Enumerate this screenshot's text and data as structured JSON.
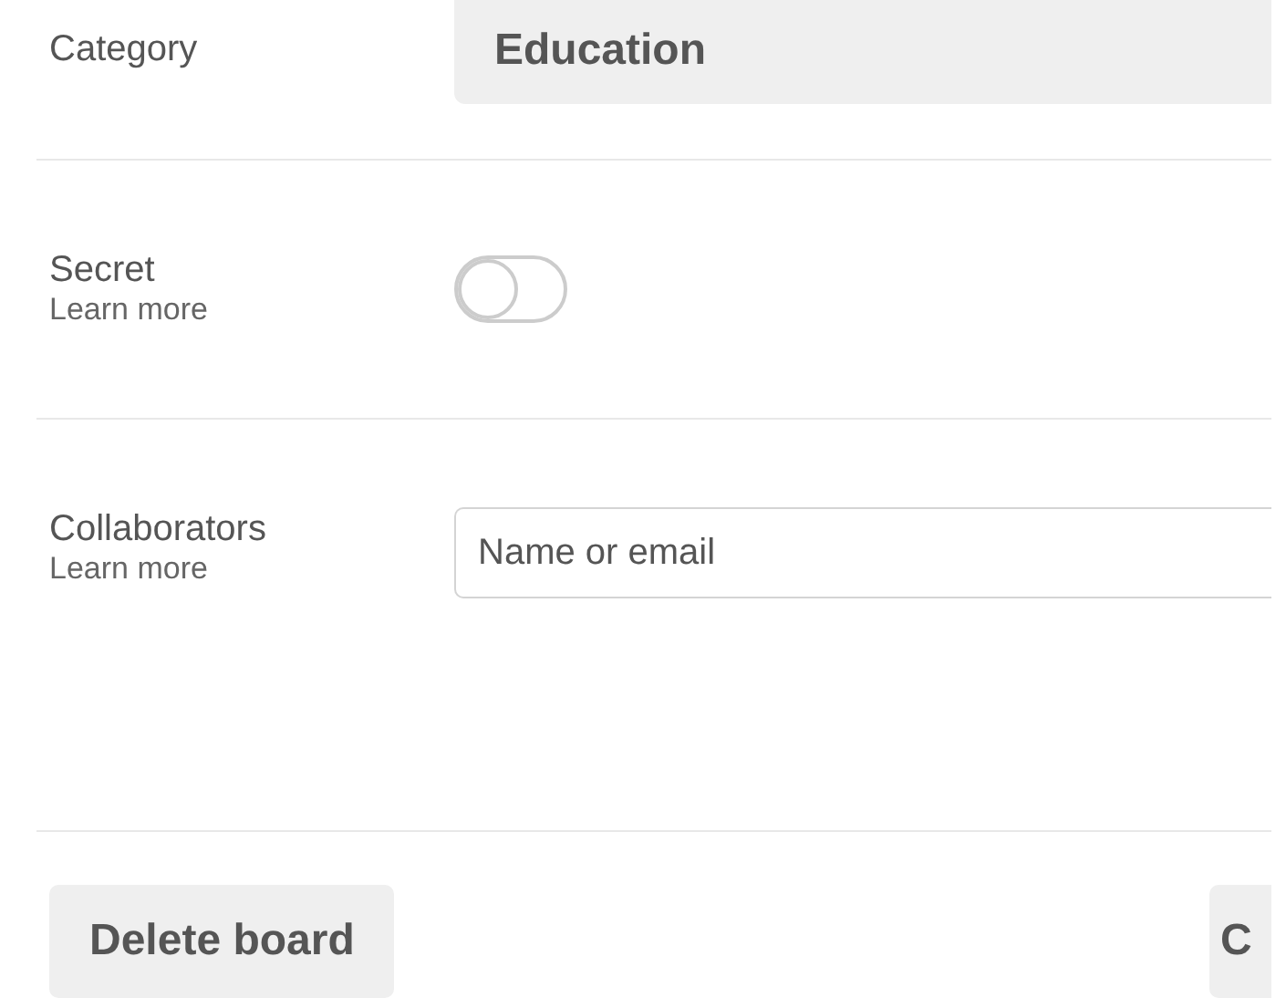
{
  "rows": [
    {
      "kind": "select",
      "label": "Category",
      "value": "Education"
    },
    {
      "kind": "toggle",
      "label": "Secret",
      "link": "Learn more",
      "on": false
    },
    {
      "kind": "input",
      "label": "Collaborators",
      "link": "Learn more",
      "placeholder": "Name or email"
    }
  ],
  "footer": {
    "delete_button": "Delete board",
    "right_button": "C"
  }
}
